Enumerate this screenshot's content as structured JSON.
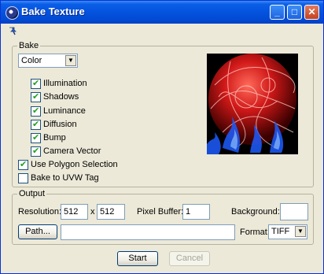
{
  "window": {
    "title": "Bake Texture"
  },
  "bake": {
    "group_label": "Bake",
    "channel_select": "Color",
    "options": [
      {
        "label": "Illumination",
        "checked": true
      },
      {
        "label": "Shadows",
        "checked": true
      },
      {
        "label": "Luminance",
        "checked": true
      },
      {
        "label": "Diffusion",
        "checked": true
      },
      {
        "label": "Bump",
        "checked": true
      },
      {
        "label": "Camera Vector",
        "checked": true
      }
    ],
    "use_polygon_selection": {
      "label": "Use Polygon Selection",
      "checked": true
    },
    "bake_to_uvw": {
      "label": "Bake to UVW Tag",
      "checked": false
    }
  },
  "output": {
    "group_label": "Output",
    "resolution_label": "Resolution:",
    "res_width": "512",
    "res_x": "x",
    "res_height": "512",
    "pixel_buffer_label": "Pixel Buffer:",
    "pixel_buffer": "1",
    "background_label": "Background:",
    "path_button": "Path...",
    "path_value": "",
    "format_label": "Format:",
    "format_value": "TIFF"
  },
  "footer": {
    "start_button": "Start",
    "cancel_button": "Cancel"
  }
}
